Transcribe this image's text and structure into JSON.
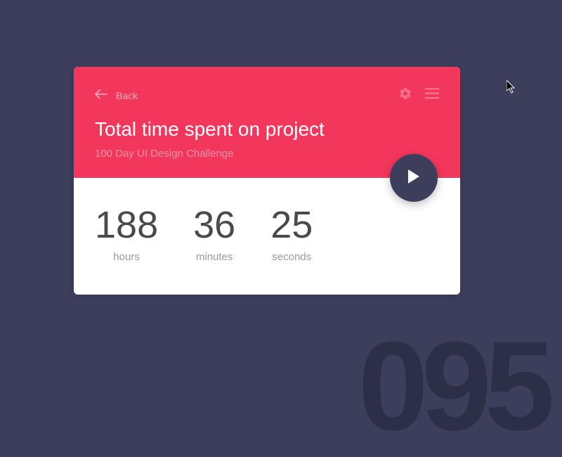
{
  "background_number": "095",
  "header": {
    "back_label": "Back",
    "title": "Total time spent on project",
    "subtitle": "100 Day UI Design Challenge"
  },
  "timer": {
    "hours": {
      "value": "188",
      "label": "hours"
    },
    "minutes": {
      "value": "36",
      "label": "minutes"
    },
    "seconds": {
      "value": "25",
      "label": "seconds"
    }
  }
}
